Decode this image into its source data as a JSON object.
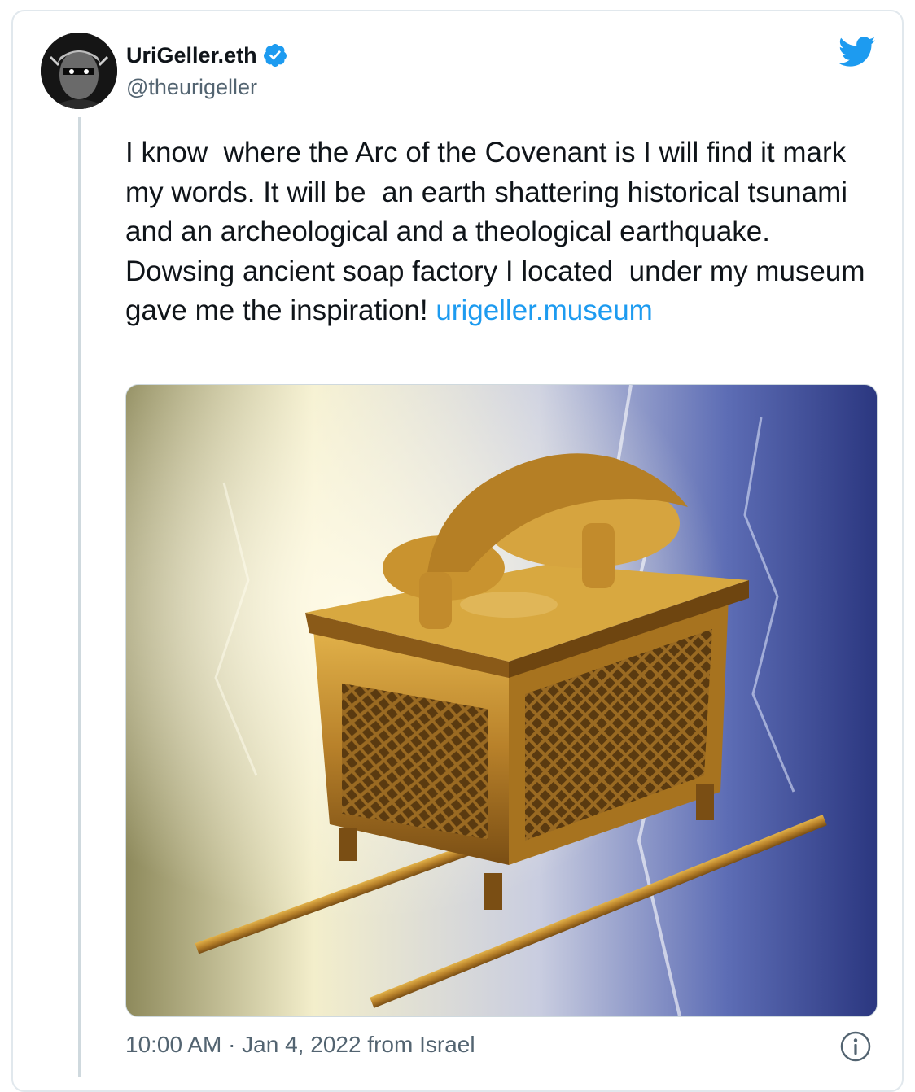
{
  "tweet": {
    "display_name": "UriGeller.eth",
    "handle": "@theurigeller",
    "text_before_link": "I know  where the Arc of the Covenant is I will find it mark my words. It will be  an earth shattering historical tsunami and an archeological and a theological earthquake. Dowsing ancient soap factory I located  under my museum gave me the inspiration! ",
    "link_text": "urigeller.museum",
    "timestamp": "10:00 AM · Jan 4, 2022 from Israel",
    "media_description_icon": "ark-of-covenant-image"
  },
  "icons": {
    "verified": "verified-badge-icon",
    "brand": "twitter-bird-icon",
    "info": "info-icon"
  },
  "colors": {
    "link": "#1d9bf0",
    "verified": "#1d9bf0",
    "twitter": "#1d9bf0",
    "secondary_text": "#536471"
  }
}
